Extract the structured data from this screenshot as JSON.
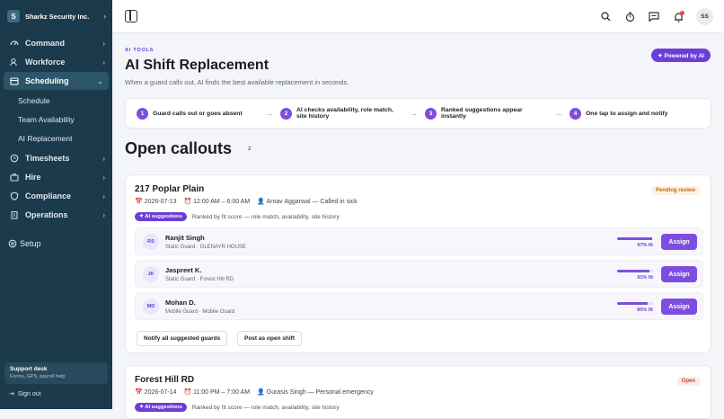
{
  "sidebar": {
    "org_initial": "S",
    "org_name": "Sharkz Security Inc.",
    "items": [
      {
        "label": "Command",
        "icon": "dashboard-icon"
      },
      {
        "label": "Workforce",
        "icon": "people-icon"
      },
      {
        "label": "Scheduling",
        "icon": "calendar-icon"
      },
      {
        "label": "Timesheets",
        "icon": "clock-icon"
      },
      {
        "label": "Hire",
        "icon": "briefcase-icon"
      },
      {
        "label": "Compliance",
        "icon": "shield-icon"
      },
      {
        "label": "Operations",
        "icon": "building-icon"
      }
    ],
    "sub_items": [
      "Schedule",
      "Team Availability",
      "AI Replacement"
    ],
    "setup_label": "Setup",
    "support_title": "Support desk",
    "support_subtitle": "Forms, GPS, payroll help",
    "signout_label": "Sign out"
  },
  "topbar": {
    "avatar_initials": "SS",
    "icons": [
      "search-icon",
      "timer-icon",
      "chat-icon",
      "bell-icon"
    ]
  },
  "page": {
    "eyebrow": "AI TOOLS",
    "title": "AI Shift Replacement",
    "subtitle": "When a guard calls out, AI finds the best available replacement in seconds.",
    "powered_label": "✦ Powered by AI",
    "steps": [
      {
        "num": "1",
        "label": "Guard calls out or goes absent"
      },
      {
        "num": "2",
        "label": "AI checks availability, role match, site history"
      },
      {
        "num": "3",
        "label": "Ranked suggestions appear instantly"
      },
      {
        "num": "4",
        "label": "One tap to assign and notify"
      }
    ],
    "callouts_title": "Open callouts",
    "callouts_count": "2"
  },
  "callouts": [
    {
      "site": "217 Poplar Plain",
      "date": "2026-07-13",
      "time": "12:00 AM – 6:00 AM",
      "guard_note": "Arnav Aggarwal — Called in sick",
      "status": "Pending review",
      "status_color": "#c46a0a",
      "status_bg": "#fdf3e3",
      "ai_tag": "✦ AI suggestions",
      "ai_note": "Ranked by fit score — role match, availability, site history",
      "candidates": [
        {
          "initials": "RS",
          "name": "Ranjit Singh",
          "role": "Static Guard · GLENAYR HOUSE",
          "fit_pct": 97,
          "fit_label": "97% fit",
          "assign": "Assign"
        },
        {
          "initials": "JK",
          "name": "Jaspreet K.",
          "role": "Static Guard · Forest Hill RD",
          "fit_pct": 91,
          "fit_label": "91% fit",
          "assign": "Assign"
        },
        {
          "initials": "MD",
          "name": "Mohan D.",
          "role": "Mobile Guard · Mobile Guard",
          "fit_pct": 85,
          "fit_label": "85% fit",
          "assign": "Assign"
        }
      ],
      "actions": [
        "Notify all suggested guards",
        "Post as open shift"
      ]
    },
    {
      "site": "Forest Hill RD",
      "date": "2026-07-14",
      "time": "11:00 PM – 7:00 AM",
      "guard_note": "Gurasis Singh — Personal emergency",
      "status": "Open",
      "status_color": "#d63a3a",
      "status_bg": "#fdeaea",
      "ai_tag": "✦ AI suggestions",
      "ai_note": "Ranked by fit score — role match, availability, site history"
    }
  ]
}
